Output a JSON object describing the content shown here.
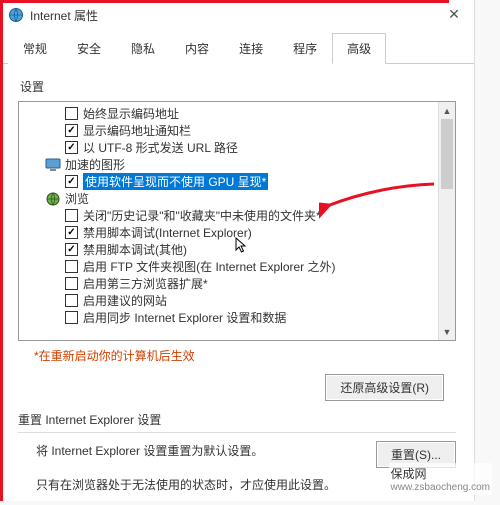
{
  "titlebar": {
    "title": "Internet 属性"
  },
  "tabs": {
    "items": [
      {
        "label": "常规"
      },
      {
        "label": "安全"
      },
      {
        "label": "隐私"
      },
      {
        "label": "内容"
      },
      {
        "label": "连接"
      },
      {
        "label": "程序"
      },
      {
        "label": "高级",
        "active": true
      }
    ]
  },
  "settings_label": "设置",
  "tree": {
    "rows": [
      {
        "type": "item",
        "indent": 2,
        "checked": false,
        "label": "始终显示编码地址"
      },
      {
        "type": "item",
        "indent": 2,
        "checked": true,
        "label": "显示编码地址通知栏"
      },
      {
        "type": "item",
        "indent": 2,
        "checked": true,
        "label": "以 UTF-8 形式发送 URL 路径"
      },
      {
        "type": "group",
        "indent": 1,
        "icon": "monitor",
        "label": "加速的图形"
      },
      {
        "type": "item",
        "indent": 2,
        "checked": true,
        "highlight": true,
        "label": "使用软件呈现而不使用 GPU 呈现*"
      },
      {
        "type": "group",
        "indent": 1,
        "icon": "globe",
        "label": "浏览"
      },
      {
        "type": "item",
        "indent": 2,
        "checked": false,
        "label": "关闭\"历史记录\"和\"收藏夹\"中未使用的文件夹*"
      },
      {
        "type": "item",
        "indent": 2,
        "checked": true,
        "label": "禁用脚本调试(Internet Explorer)"
      },
      {
        "type": "item",
        "indent": 2,
        "checked": true,
        "label": "禁用脚本调试(其他)"
      },
      {
        "type": "item",
        "indent": 2,
        "checked": false,
        "label": "启用 FTP 文件夹视图(在 Internet Explorer 之外)"
      },
      {
        "type": "item",
        "indent": 2,
        "checked": false,
        "label": "启用第三方浏览器扩展*"
      },
      {
        "type": "item",
        "indent": 2,
        "checked": false,
        "label": "启用建议的网站"
      },
      {
        "type": "item",
        "indent": 2,
        "checked": false,
        "label": "启用同步 Internet Explorer 设置和数据"
      }
    ]
  },
  "restart_note": "*在重新启动你的计算机后生效",
  "restore_button": "还原高级设置(R)",
  "reset": {
    "heading": "重置 Internet Explorer 设置",
    "text": "将 Internet Explorer 设置重置为默认设置。",
    "button": "重置(S)..."
  },
  "bottom_note": "只有在浏览器处于无法使用的状态时，才应使用此设置。",
  "watermark": {
    "brand": "保成网",
    "url": "www.zsbaocheng.com"
  }
}
